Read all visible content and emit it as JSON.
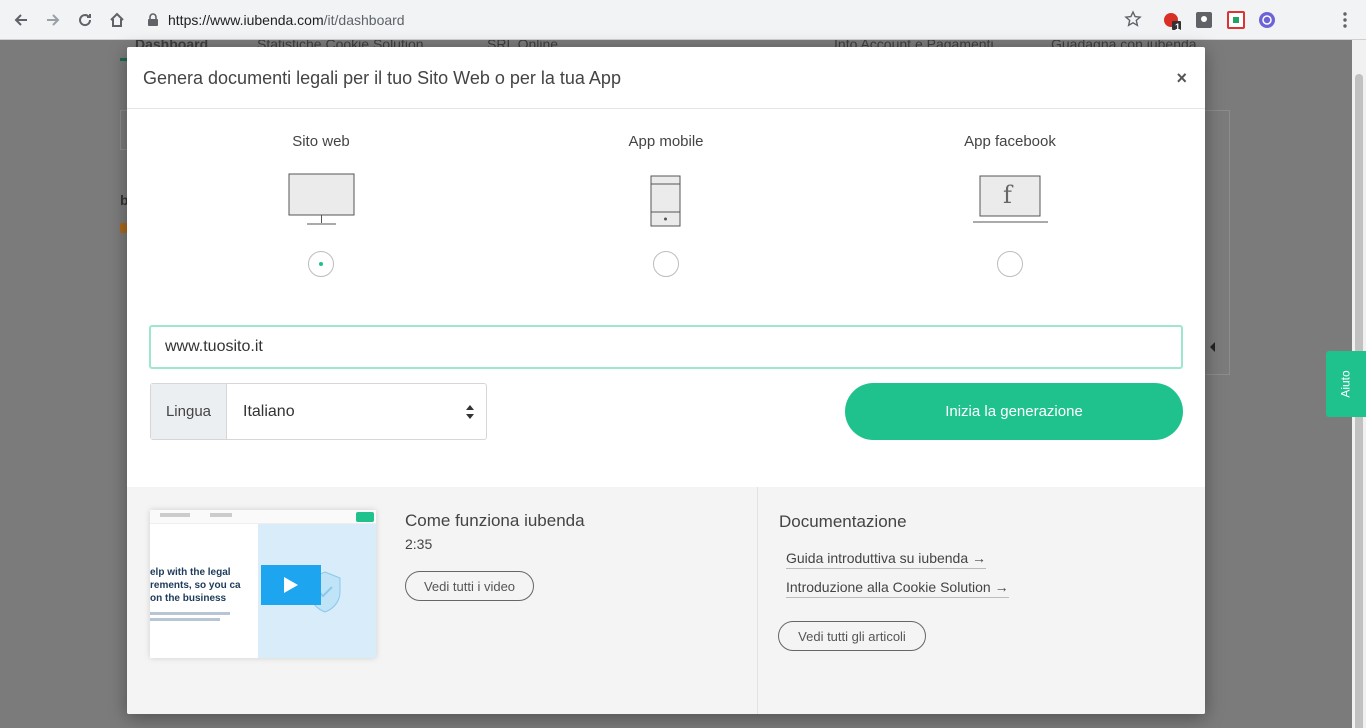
{
  "browser": {
    "url_host": "https://www.iubenda.com",
    "url_path": "/it/dashboard",
    "ext_badge": "1"
  },
  "background_page": {
    "tabs": [
      "Dashboard",
      "Statistiche Cookie Solution",
      "SRL Online",
      "Info Account e Pagamenti",
      "Guadagna con iubenda"
    ],
    "side_letter": "b",
    "help_tab": "Aiuto"
  },
  "modal": {
    "title": "Genera documenti legali per il tuo Sito Web o per la tua App",
    "close_label": "×",
    "platforms": [
      {
        "label": "Sito web",
        "icon": "desktop-monitor-icon",
        "selected": true
      },
      {
        "label": "App mobile",
        "icon": "mobile-phone-icon",
        "selected": false
      },
      {
        "label": "App facebook",
        "icon": "facebook-app-icon",
        "selected": false
      }
    ],
    "facebook_glyph": "f",
    "site_input_value": "www.tuosito.it",
    "language_label": "Lingua",
    "language_value": "Italiano",
    "start_button": "Inizia la generazione"
  },
  "footer": {
    "video": {
      "title": "Come funziona iubenda",
      "duration": "2:35",
      "button": "Vedi tutti i video",
      "thumb_tagline": [
        "elp with the legal",
        "rements, so you ca",
        "on the business"
      ]
    },
    "docs": {
      "title": "Documentazione",
      "links": [
        "Guida introduttiva su iubenda →",
        "Introduzione alla Cookie Solution →"
      ],
      "button": "Vedi tutti gli articoli"
    }
  },
  "colors": {
    "accent": "#1fc28c",
    "input_focus": "#9fe6cf",
    "overlay": "#7b7b7b"
  }
}
